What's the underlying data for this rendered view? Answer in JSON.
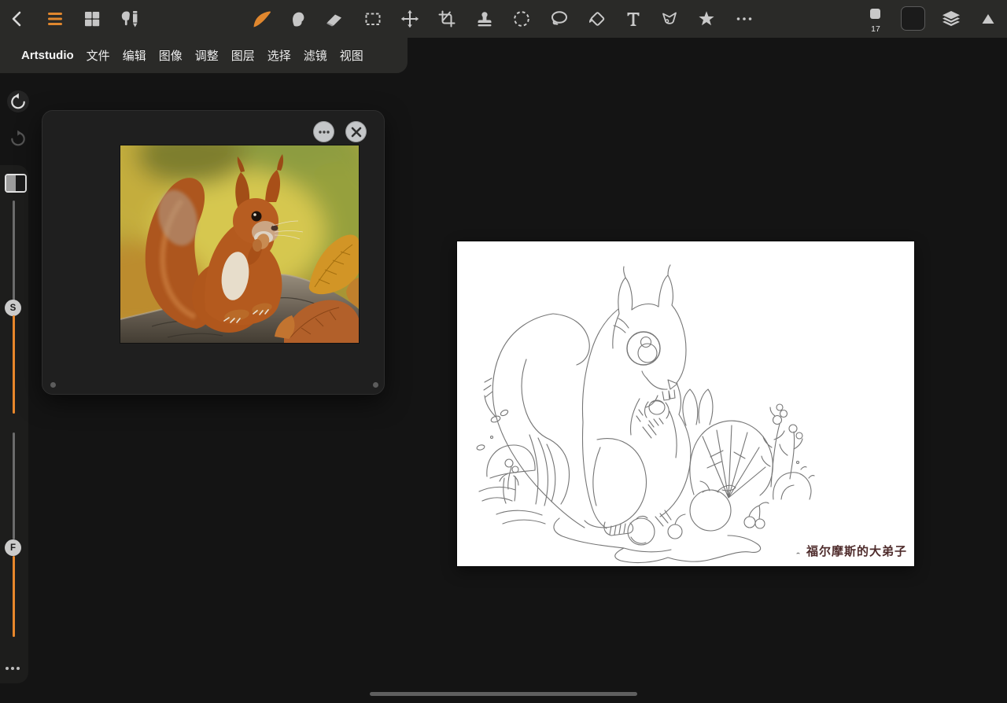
{
  "app": {
    "name": "Artstudio"
  },
  "menu_bar": {
    "items": [
      "文件",
      "编辑",
      "图像",
      "调整",
      "图层",
      "选择",
      "滤镜",
      "视图"
    ]
  },
  "toolbar": {
    "left_tools": [
      "back",
      "main-menu",
      "gallery",
      "touch-pencil-settings"
    ],
    "tools": [
      "paint",
      "smudge",
      "erase",
      "select-rect",
      "move-transform",
      "crop",
      "clone-stamp",
      "select-ellipse",
      "select-lasso",
      "fill-bucket",
      "text",
      "pen",
      "shape-star",
      "more"
    ],
    "brush_size": "17",
    "current_color": "#1b1b1b",
    "accent_color": "#e0872e"
  },
  "left_panel": {
    "tools": [
      "undo",
      "redo",
      "split-preview"
    ],
    "slider_top_label": "S",
    "slider_bottom_label": "F"
  },
  "reference_panel": {
    "buttons": [
      "more",
      "close"
    ]
  },
  "canvas": {
    "signature": "福尔摩斯的大弟子"
  }
}
